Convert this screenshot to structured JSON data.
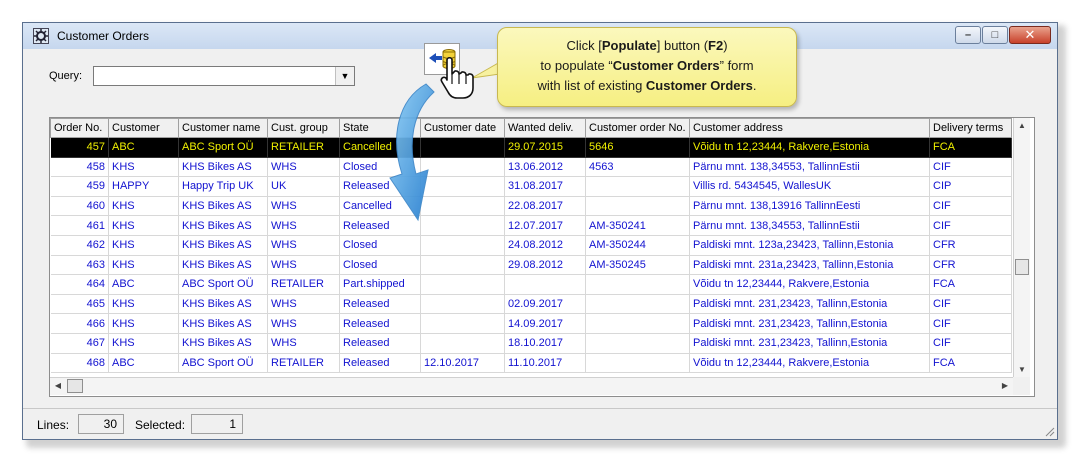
{
  "window": {
    "title": "Customer Orders"
  },
  "query": {
    "label": "Query:",
    "value": ""
  },
  "callout": {
    "line1_pre": "Click [",
    "line1_bold": "Populate",
    "line1_mid": "] button (",
    "line1_bold2": "F2",
    "line1_post": ")",
    "line2_pre": "to populate “",
    "line2_bold": "Customer Orders",
    "line2_post": "” form",
    "line3_pre": "with list of existing ",
    "line3_bold": "Customer Orders",
    "line3_post": "."
  },
  "table": {
    "columns": [
      "Order No.",
      "Customer",
      "Customer name",
      "Cust. group",
      "State",
      "Customer date",
      "Wanted deliv.",
      "Customer order No.",
      "Customer address",
      "Delivery terms"
    ],
    "rows": [
      [
        "457",
        "ABC",
        "ABC Sport OÜ",
        "RETAILER",
        "Cancelled",
        "",
        "29.07.2015",
        "5646",
        "Võidu tn 12,23444, Rakvere,Estonia",
        "FCA"
      ],
      [
        "458",
        "KHS",
        "KHS Bikes AS",
        "WHS",
        "Closed",
        "",
        "13.06.2012",
        "4563",
        "Pärnu mnt. 138,34553, TallinnEstii",
        "CIF"
      ],
      [
        "459",
        "HAPPY",
        "Happy Trip UK",
        "UK",
        "Released",
        "",
        "31.08.2017",
        "",
        "Villis rd. 5434545, WallesUK",
        "CIP"
      ],
      [
        "460",
        "KHS",
        "KHS Bikes AS",
        "WHS",
        "Cancelled",
        "",
        "22.08.2017",
        "",
        "Pärnu mnt. 138,13916 TallinnEesti",
        "CIF"
      ],
      [
        "461",
        "KHS",
        "KHS Bikes AS",
        "WHS",
        "Released",
        "",
        "12.07.2017",
        "AM-350241",
        "Pärnu mnt. 138,34553, TallinnEstii",
        "CIF"
      ],
      [
        "462",
        "KHS",
        "KHS Bikes AS",
        "WHS",
        "Closed",
        "",
        "24.08.2012",
        "AM-350244",
        "Paldiski mnt. 123a,23423, Tallinn,Estonia",
        "CFR"
      ],
      [
        "463",
        "KHS",
        "KHS Bikes AS",
        "WHS",
        "Closed",
        "",
        "29.08.2012",
        "AM-350245",
        "Paldiski mnt. 231a,23423, Tallinn,Estonia",
        "CFR"
      ],
      [
        "464",
        "ABC",
        "ABC Sport OÜ",
        "RETAILER",
        "Part.shipped",
        "",
        "",
        "",
        "Võidu tn 12,23444, Rakvere,Estonia",
        "FCA"
      ],
      [
        "465",
        "KHS",
        "KHS Bikes AS",
        "WHS",
        "Released",
        "",
        "02.09.2017",
        "",
        "Paldiski mnt. 231,23423, Tallinn,Estonia",
        "CIF"
      ],
      [
        "466",
        "KHS",
        "KHS Bikes AS",
        "WHS",
        "Released",
        "",
        "14.09.2017",
        "",
        "Paldiski mnt. 231,23423, Tallinn,Estonia",
        "CIF"
      ],
      [
        "467",
        "KHS",
        "KHS Bikes AS",
        "WHS",
        "Released",
        "",
        "18.10.2017",
        "",
        "Paldiski mnt. 231,23423, Tallinn,Estonia",
        "CIF"
      ],
      [
        "468",
        "ABC",
        "ABC Sport OÜ",
        "RETAILER",
        "Released",
        "12.10.2017",
        "11.10.2017",
        "",
        "Võidu tn 12,23444, Rakvere,Estonia",
        "FCA"
      ]
    ],
    "selected_row": 0
  },
  "status": {
    "lines_label": "Lines:",
    "lines_value": "30",
    "selected_label": "Selected:",
    "selected_value": "1"
  },
  "colors": {
    "row_text": "#1212d0",
    "selected_bg": "#000000",
    "selected_text": "#f0f000",
    "callout_bg": "#f8f3a0",
    "arrow": "#2f8fd8"
  },
  "icons": {
    "window_icon": "app-gear-icon",
    "populate_icon": "populate-database-icon",
    "cursor_icon": "hand-pointer-icon"
  }
}
